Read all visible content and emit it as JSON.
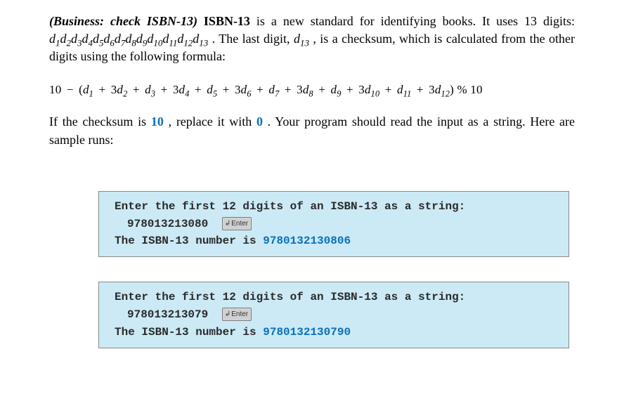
{
  "intro": {
    "label": "(Business: check ISBN-13)",
    "name": "ISBN-13",
    "text1": " is a new standard for identifying books. It uses 13 digits: ",
    "digits": "d₁d₂d₃d₄d₅d₆d₇d₈d₉d₁₀d₁₁d₁₂d₁₃",
    "text2": ". The last digit, ",
    "d13": "d₁₃",
    "text3": ", is a checksum, which is calculated from the other digits using the following formula:"
  },
  "formula_parts": {
    "lead": "10",
    "minus": "−",
    "open": "(",
    "terms": [
      {
        "coef": "",
        "d": "d",
        "sub": "1"
      },
      {
        "coef": "3",
        "d": "d",
        "sub": "2"
      },
      {
        "coef": "",
        "d": "d",
        "sub": "3"
      },
      {
        "coef": "3",
        "d": "d",
        "sub": "4"
      },
      {
        "coef": "",
        "d": "d",
        "sub": "5"
      },
      {
        "coef": "3",
        "d": "d",
        "sub": "6"
      },
      {
        "coef": "",
        "d": "d",
        "sub": "7"
      },
      {
        "coef": "3",
        "d": "d",
        "sub": "8"
      },
      {
        "coef": "",
        "d": "d",
        "sub": "9"
      },
      {
        "coef": "3",
        "d": "d",
        "sub": "10"
      },
      {
        "coef": "",
        "d": "d",
        "sub": "11"
      },
      {
        "coef": "3",
        "d": "d",
        "sub": "12"
      }
    ],
    "close": ")",
    "pct": "%",
    "mod": "10"
  },
  "second": {
    "t1": "If the checksum is ",
    "ten": "10",
    "t2": ", replace it with ",
    "zero": "0",
    "t3": ". Your program should read the input as a string. Here are sample runs:"
  },
  "samples": [
    {
      "prompt": "Enter the first 12 digits of an ISBN-13 as a string:",
      "input": "978013213080",
      "enter_label": "Enter",
      "result_prefix": "The ISBN-13 number is ",
      "result_value": "9780132130806"
    },
    {
      "prompt": "Enter the first 12 digits of an ISBN-13 as a string:",
      "input": "978013213079",
      "enter_label": "Enter",
      "result_prefix": "The ISBN-13 number is ",
      "result_value": "9780132130790"
    }
  ]
}
